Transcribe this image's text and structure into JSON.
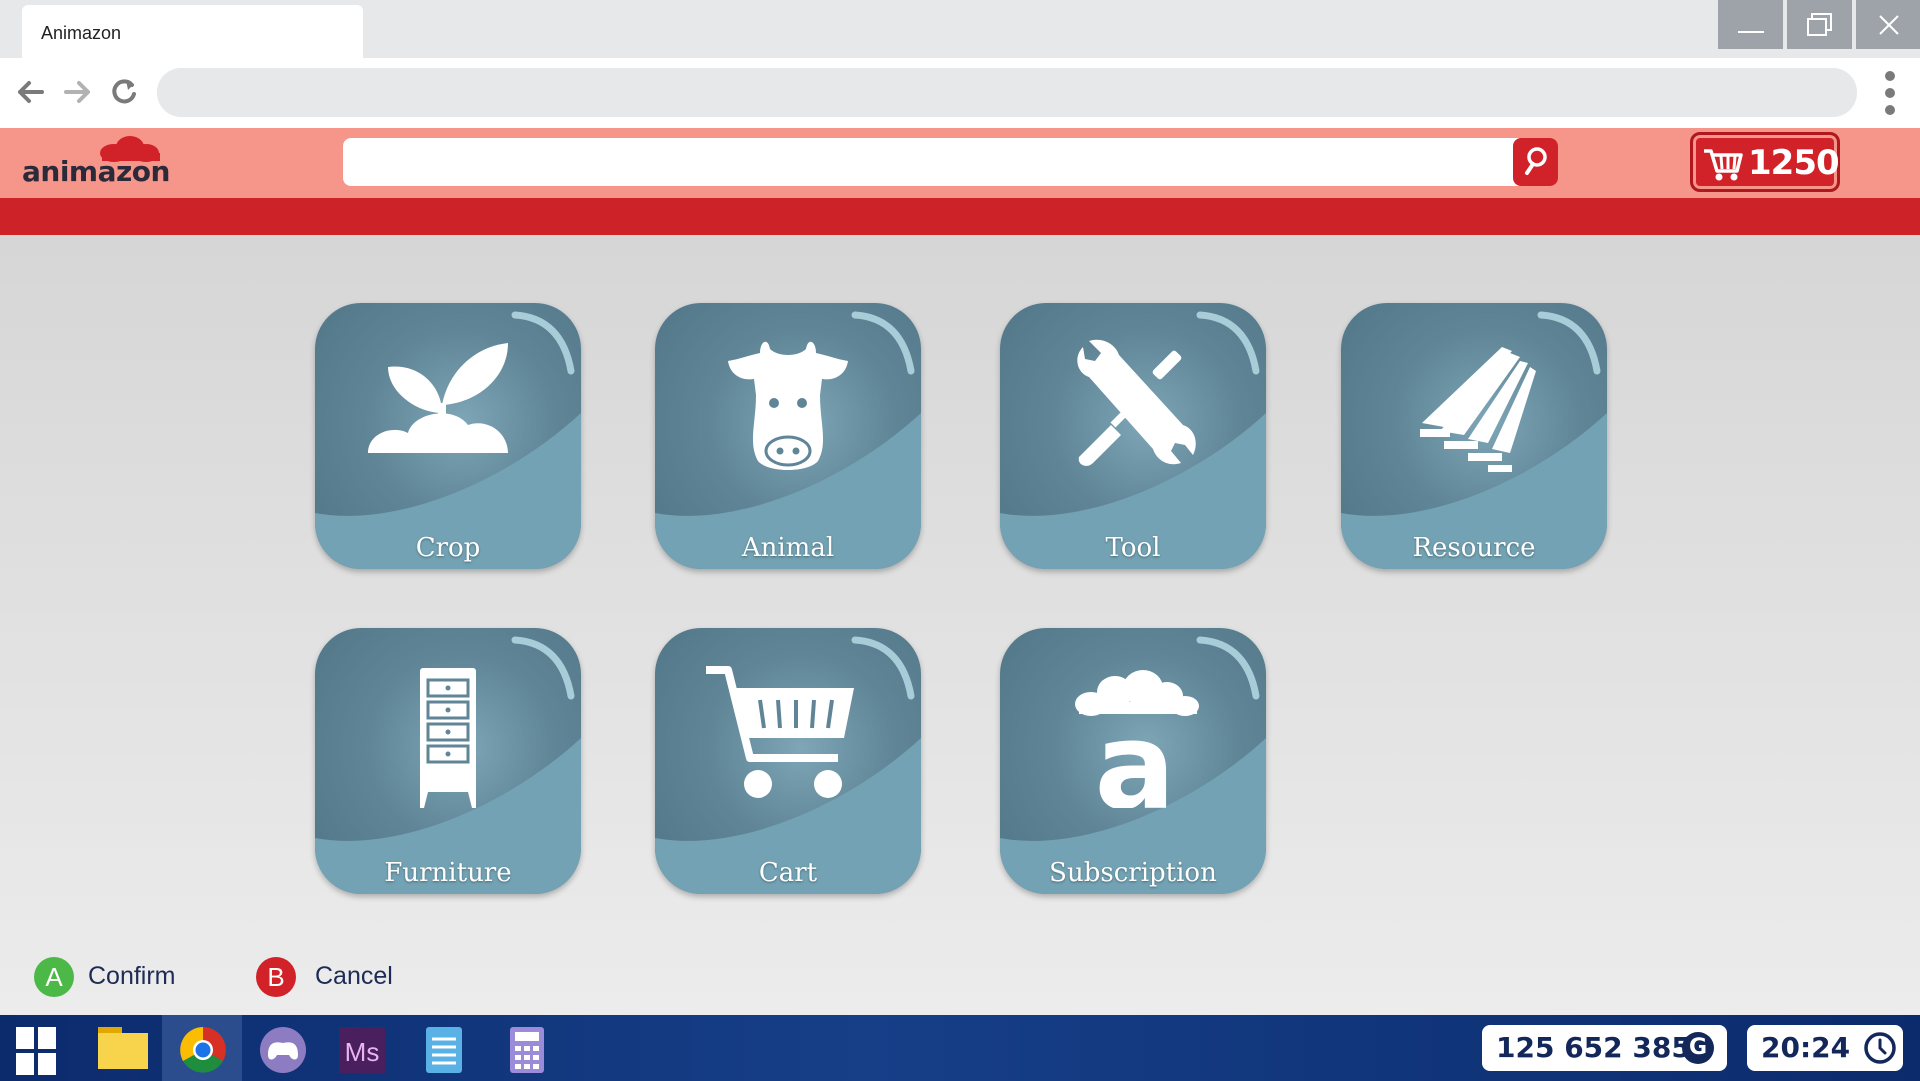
{
  "browser": {
    "tab_title": "Animazon",
    "address": "",
    "window_controls": [
      "minimize-icon",
      "restore-icon",
      "close-icon"
    ],
    "nav_icons": [
      "back-arrow-icon",
      "forward-arrow-icon",
      "reload-icon",
      "kebab-menu-icon"
    ]
  },
  "site": {
    "logo_text": "animazon",
    "search_placeholder": "",
    "search_icon": "search-icon",
    "cart_icon": "cart-icon",
    "cart_count": "1250",
    "colors": {
      "header": "#f6968a",
      "accent": "#d22229",
      "band": "#cd2328",
      "tile": "#5f8597"
    }
  },
  "categories": [
    {
      "label": "Crop",
      "icon": "sprout-icon"
    },
    {
      "label": "Animal",
      "icon": "cow-icon"
    },
    {
      "label": "Tool",
      "icon": "wrench-screwdriver-icon"
    },
    {
      "label": "Resource",
      "icon": "lumber-icon"
    },
    {
      "label": "Furniture",
      "icon": "dresser-icon"
    },
    {
      "label": "Cart",
      "icon": "shopping-cart-icon"
    },
    {
      "label": "Subscription",
      "icon": "animazon-logo-icon"
    }
  ],
  "controls": {
    "confirm": {
      "key": "A",
      "label": "Confirm",
      "color": "#4cb848"
    },
    "cancel": {
      "key": "B",
      "label": "Cancel",
      "color": "#d22229"
    }
  },
  "taskbar": {
    "apps": [
      "start-icon",
      "file-manager-icon",
      "chrome-icon",
      "game-controller-icon",
      "ms-app-icon",
      "notepad-icon",
      "calculator-icon"
    ],
    "money": "125 652 385",
    "currency_symbol": "G",
    "time": "20:24"
  }
}
